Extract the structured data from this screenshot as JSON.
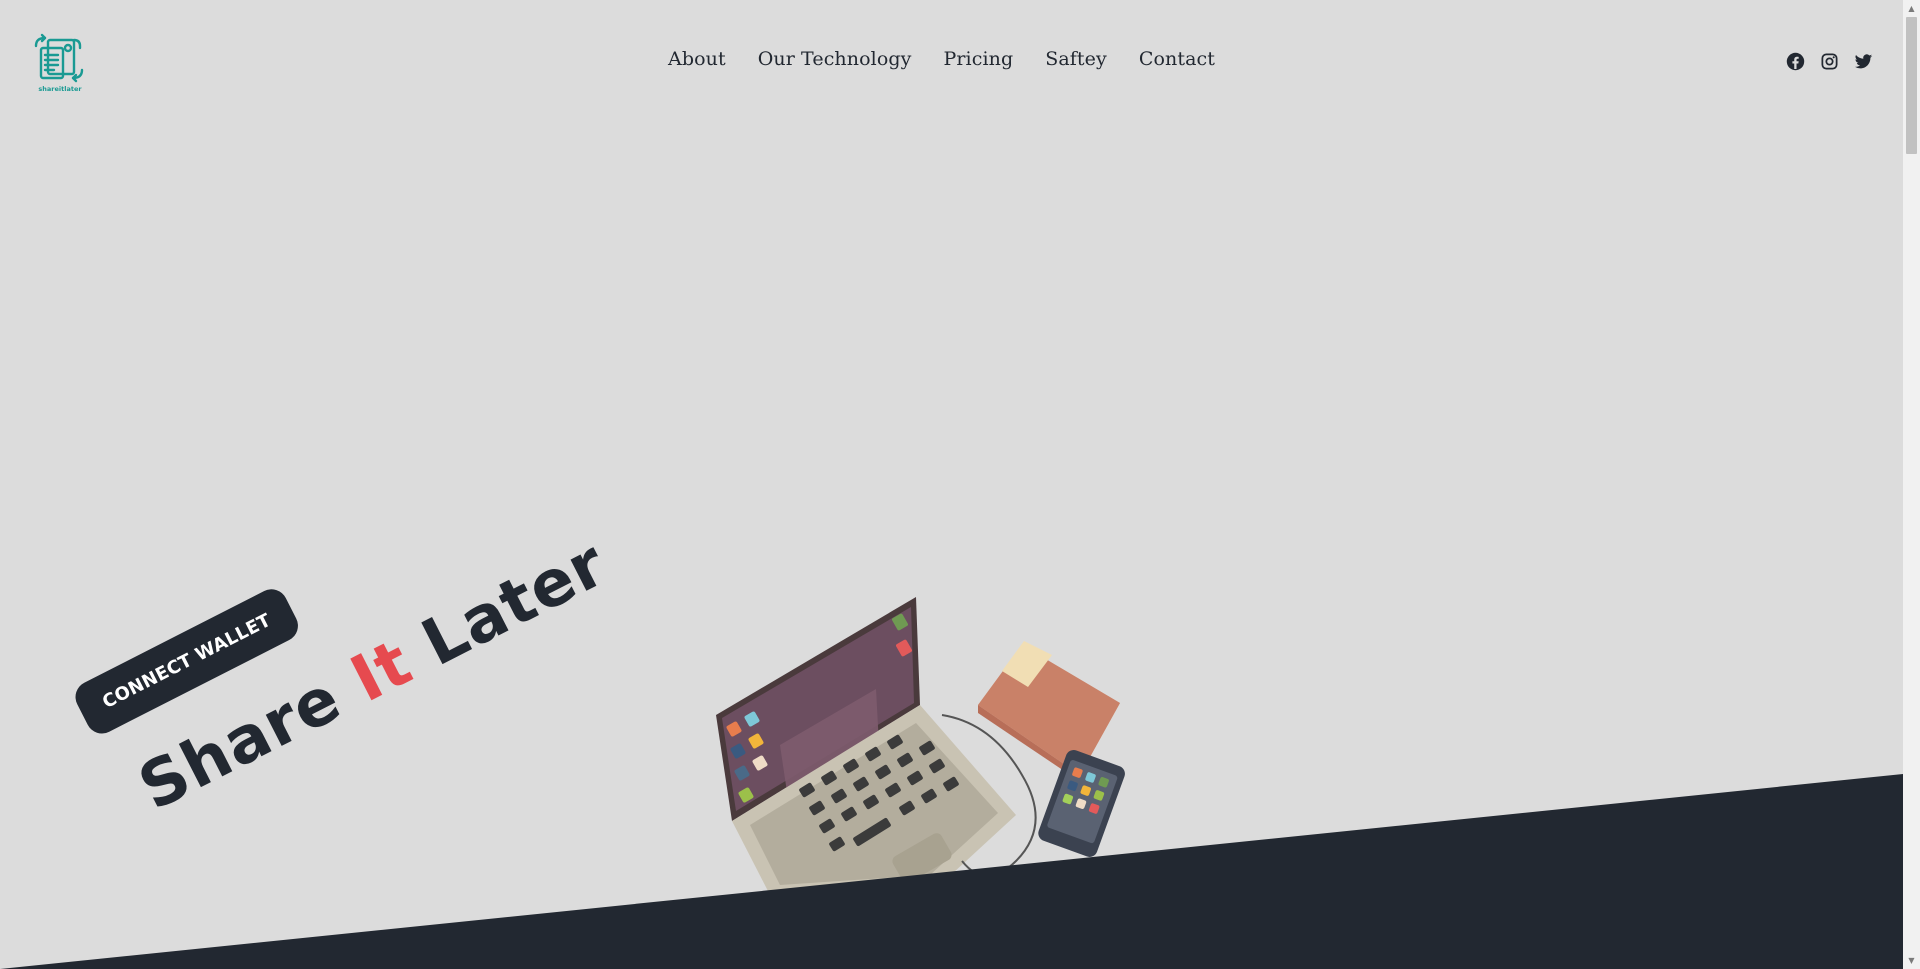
{
  "brand": {
    "logo_text": "shareitlater",
    "accent_color": "#1a9a93"
  },
  "nav": {
    "items": [
      {
        "label": "About"
      },
      {
        "label": "Our Technology"
      },
      {
        "label": "Pricing"
      },
      {
        "label": "Saftey"
      },
      {
        "label": "Contact"
      }
    ]
  },
  "socials": [
    {
      "icon": "facebook-icon"
    },
    {
      "icon": "instagram-icon"
    },
    {
      "icon": "twitter-icon"
    }
  ],
  "hero": {
    "button_label": "CONNECT WALLET",
    "tagline_part1": "Share ",
    "tagline_accent": "It",
    "tagline_part2": " Later",
    "accent_color": "#e64a4f",
    "dark_color": "#222831"
  },
  "background_color": "#dcdcdc"
}
